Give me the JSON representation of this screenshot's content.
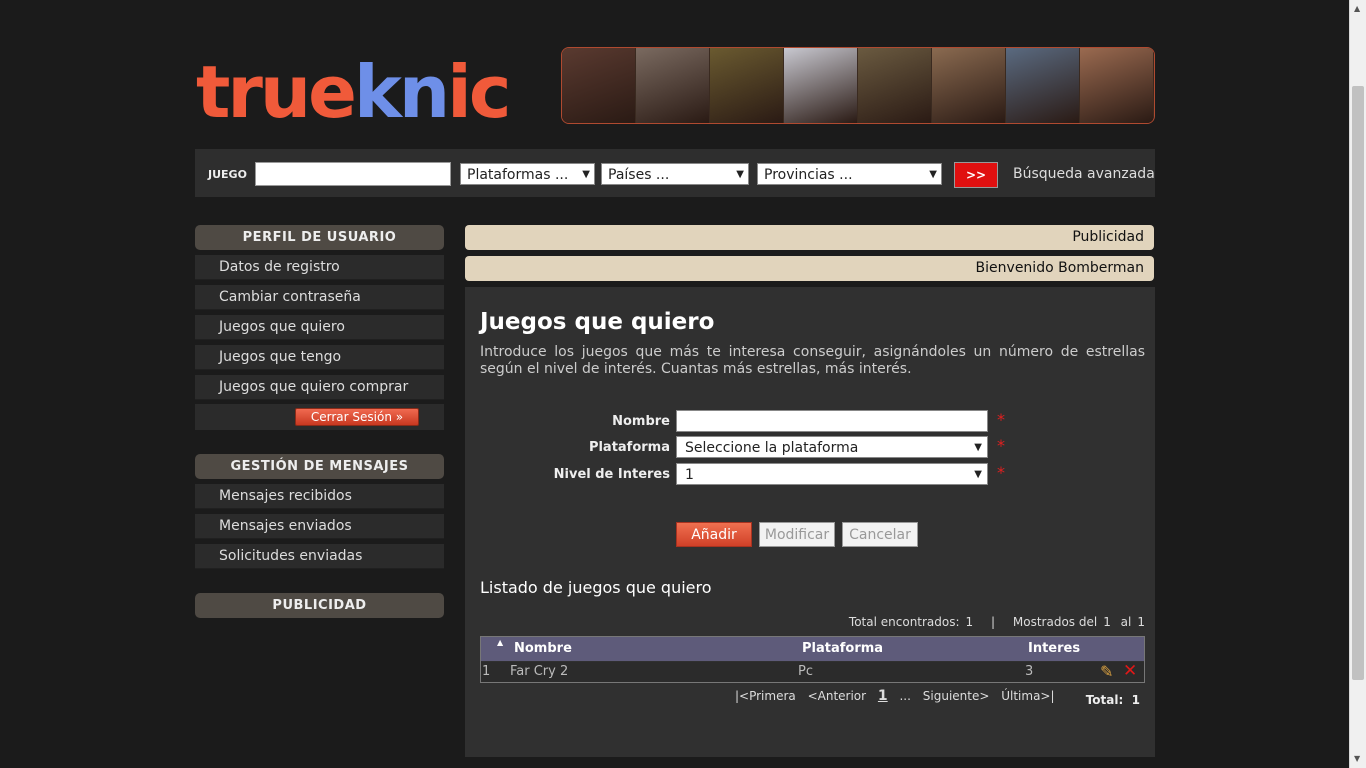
{
  "logo": {
    "part1": "true",
    "part2": "kn",
    "part3": "ic"
  },
  "banner": {
    "faces": [
      "#5a3a30",
      "#7a6a60",
      "#6a5a30",
      "#c8c8d0",
      "#6a5a40",
      "#8a6a50",
      "#5a6a80",
      "#9a6a50"
    ]
  },
  "search": {
    "label": "JUEGO",
    "platform": "Plataformas ...",
    "country": "Países ...",
    "province": "Provincias ...",
    "go": ">>",
    "advanced": "Búsqueda avanzada"
  },
  "sidebar": {
    "profile_title": "PERFIL DE USUARIO",
    "profile_items": [
      "Datos de registro",
      "Cambiar contraseña",
      "Juegos que quiero",
      "Juegos que tengo",
      "Juegos que quiero comprar"
    ],
    "logout": "Cerrar Sesión »",
    "messages_title": "GESTIÓN DE MENSAJES",
    "message_items": [
      "Mensajes recibidos",
      "Mensajes enviados",
      "Solicitudes enviadas"
    ],
    "ads_title": "PUBLICIDAD"
  },
  "content": {
    "ads_bar": "Publicidad",
    "welcome": "Bienvenido Bomberman",
    "title": "Juegos que quiero",
    "intro": "Introduce los juegos que más te interesa conseguir, asignándoles un número de estrellas según el nivel de interés. Cuantas más estrellas, más interés.",
    "form": {
      "name_label": "Nombre",
      "name_value": "",
      "platform_label": "Plataforma",
      "platform_value": "Seleccione la plataforma",
      "level_label": "Nivel de Interes",
      "level_value": "1",
      "required": "*"
    },
    "buttons": {
      "add": "Añadir",
      "modify": "Modificar",
      "cancel": "Cancelar"
    },
    "list_title": "Listado de juegos que quiero",
    "totals": {
      "found_label": "Total encontrados:",
      "found": "1",
      "sep": "|",
      "shown_label": "Mostrados del",
      "from": "1",
      "to_label": "al",
      "to": "1"
    },
    "table": {
      "headers": {
        "name": "Nombre",
        "platform": "Plataforma",
        "interest": "Interes"
      },
      "rows": [
        {
          "index": "1",
          "name": "Far Cry 2",
          "platform": "Pc",
          "interest": "3"
        }
      ]
    },
    "pager": {
      "first": "|<Primera",
      "prev": "<Anterior",
      "page": "1",
      "dots": "...",
      "next": "Siguiente>",
      "last": "Última>|"
    },
    "grand_total": {
      "label": "Total:",
      "value": "1"
    }
  }
}
